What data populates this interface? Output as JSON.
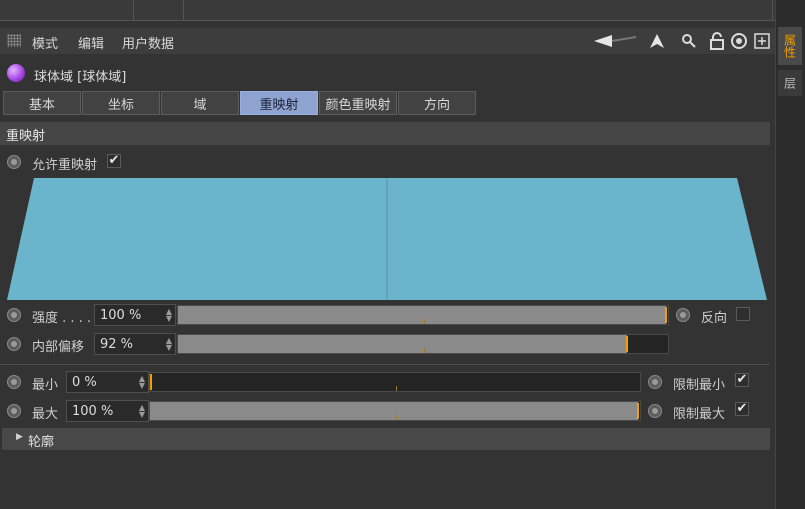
{
  "menu": {
    "mode": "模式",
    "edit": "编辑",
    "user_data": "用户数据"
  },
  "object": {
    "title": "球体域 [球体域]",
    "color": "#a040e0"
  },
  "tabs": [
    {
      "label": "基本"
    },
    {
      "label": "坐标"
    },
    {
      "label": "域"
    },
    {
      "label": "重映射",
      "active": true
    },
    {
      "label": "颜色重映射"
    },
    {
      "label": "方向"
    }
  ],
  "section": {
    "title": "重映射"
  },
  "enable_remap": {
    "label": "允许重映射",
    "checked": true,
    "check_glyph": "✔"
  },
  "curve_color": "#6ab4cc",
  "strength": {
    "label": "强度 . . . .",
    "value": "100 %",
    "fraction": 1.0
  },
  "invert": {
    "label": "反向",
    "checked": false
  },
  "inner_offset": {
    "label": "内部偏移",
    "value": "92 %",
    "fraction": 0.92
  },
  "min": {
    "label": "最小",
    "value": "0 %",
    "fraction": 0.0
  },
  "max": {
    "label": "最大",
    "value": "100 %",
    "fraction": 1.0
  },
  "clamp_min": {
    "label": "限制最小",
    "checked": true,
    "check_glyph": "✔"
  },
  "clamp_max": {
    "label": "限制最大",
    "checked": true,
    "check_glyph": "✔"
  },
  "profile": {
    "label": "轮廓"
  },
  "right_tabs": {
    "attributes": "属性",
    "layers": "层"
  },
  "accent_color": "#f0a000"
}
